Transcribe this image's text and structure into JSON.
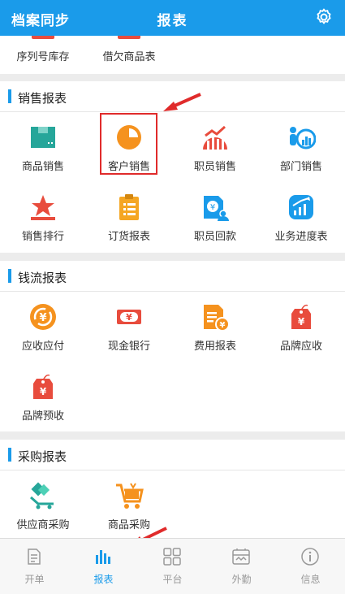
{
  "header": {
    "left_label": "档案同步",
    "title": "报表"
  },
  "top_items": [
    {
      "label": "序列号库存",
      "icon": "serial-stock-icon",
      "color": "#e84c3d"
    },
    {
      "label": "借欠商品表",
      "icon": "borrowed-goods-icon",
      "color": "#e84c3d"
    }
  ],
  "sections": [
    {
      "title": "销售报表",
      "items": [
        {
          "label": "商品销售",
          "icon": "goods-box-icon",
          "color": "#26a69a"
        },
        {
          "label": "客户销售",
          "icon": "pie-chart-icon",
          "color": "#f5921e"
        },
        {
          "label": "职员销售",
          "icon": "trend-chart-icon",
          "color": "#e84c3d"
        },
        {
          "label": "部门销售",
          "icon": "dept-chart-icon",
          "color": "#1a9bea"
        },
        {
          "label": "销售排行",
          "icon": "star-podium-icon",
          "color": "#e84c3d"
        },
        {
          "label": "订货报表",
          "icon": "clipboard-icon",
          "color": "#f5a623"
        },
        {
          "label": "职员回款",
          "icon": "payment-user-icon",
          "color": "#1a9bea"
        },
        {
          "label": "业务进度表",
          "icon": "progress-chart-icon",
          "color": "#1a9bea"
        }
      ]
    },
    {
      "title": "钱流报表",
      "items": [
        {
          "label": "应收应付",
          "icon": "yuan-cycle-icon",
          "color": "#f5921e"
        },
        {
          "label": "现金银行",
          "icon": "cash-icon",
          "color": "#e84c3d"
        },
        {
          "label": "费用报表",
          "icon": "expense-doc-icon",
          "color": "#f5921e"
        },
        {
          "label": "品牌应收",
          "icon": "brand-tag-icon",
          "color": "#e84c3d"
        },
        {
          "label": "品牌预收",
          "icon": "brand-tag-icon",
          "color": "#e84c3d"
        }
      ]
    },
    {
      "title": "采购报表",
      "items": [
        {
          "label": "供应商采购",
          "icon": "supplier-cart-icon",
          "color": "#26a69a"
        },
        {
          "label": "商品采购",
          "icon": "shopping-cart-icon",
          "color": "#f5921e"
        }
      ]
    }
  ],
  "tabbar": [
    {
      "label": "开单",
      "icon": "document-icon",
      "active": false
    },
    {
      "label": "报表",
      "icon": "bar-chart-icon",
      "active": true
    },
    {
      "label": "平台",
      "icon": "grid-icon",
      "active": false
    },
    {
      "label": "外勤",
      "icon": "map-icon",
      "active": false
    },
    {
      "label": "信息",
      "icon": "info-icon",
      "active": false
    }
  ],
  "colors": {
    "accent": "#1a9bea",
    "annotation": "#e02b2b"
  }
}
